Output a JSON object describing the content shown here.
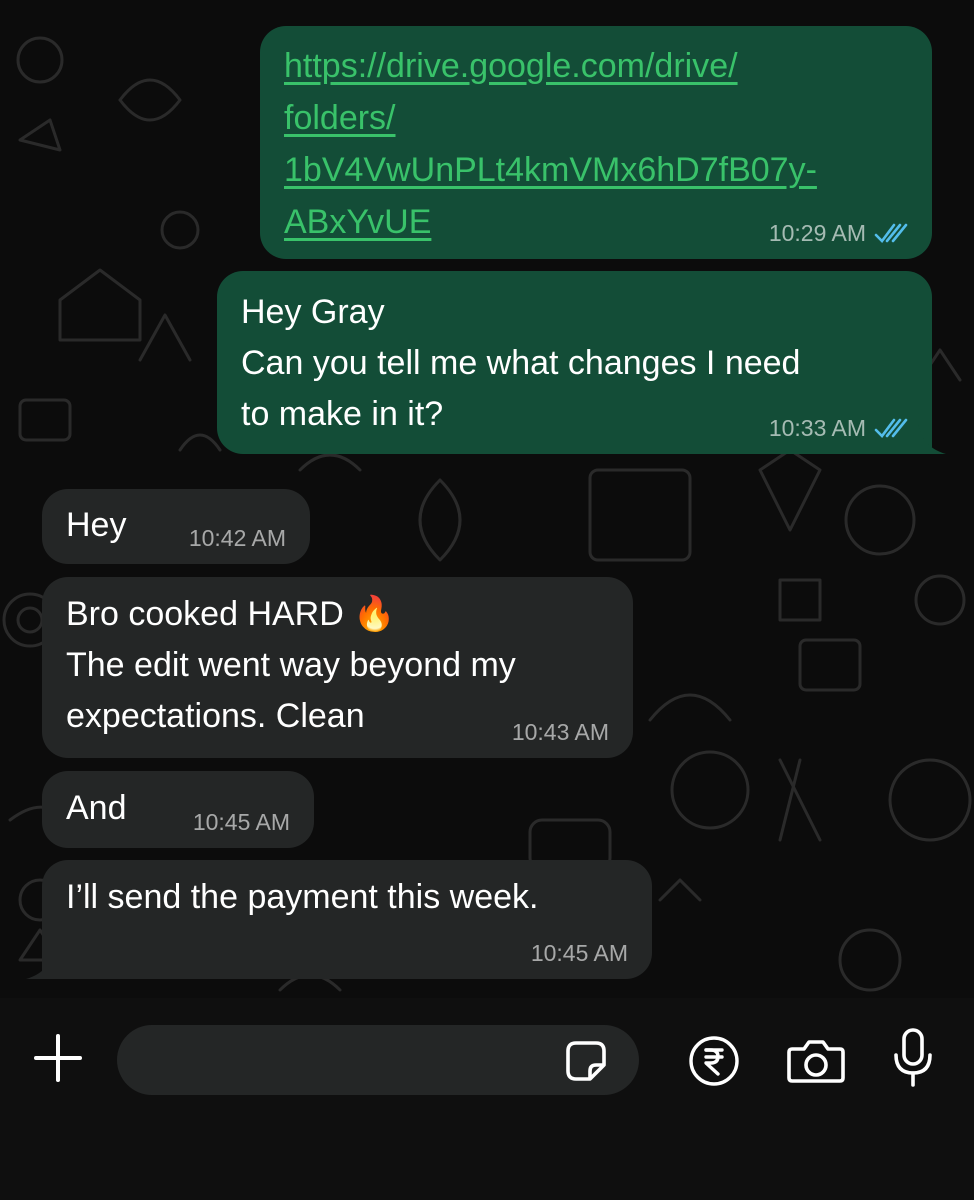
{
  "messages": [
    {
      "id": "m1",
      "direction": "outgoing",
      "link_lines": [
        "https://drive.google.com/drive/",
        "folders/",
        "1bV4VwUnPLt4kmVMx6hD7fB07y-",
        "ABxYvUE"
      ],
      "time": "10:29 AM",
      "read": true
    },
    {
      "id": "m2",
      "direction": "outgoing",
      "lines": [
        "Hey Gray",
        "Can you tell me what changes I need",
        "to make in it?"
      ],
      "time": "10:33 AM",
      "read": true
    },
    {
      "id": "m3",
      "direction": "incoming",
      "lines": [
        "Hey"
      ],
      "time": "10:42 AM"
    },
    {
      "id": "m4",
      "direction": "incoming",
      "lines": [
        "Bro cooked HARD 🔥",
        "The edit went way beyond my",
        "expectations. Clean"
      ],
      "time": "10:43 AM"
    },
    {
      "id": "m5",
      "direction": "incoming",
      "lines": [
        "And"
      ],
      "time": "10:45 AM"
    },
    {
      "id": "m6",
      "direction": "incoming",
      "lines": [
        "I’ll send the payment this week."
      ],
      "time": "10:45 AM"
    }
  ],
  "composer": {
    "input_value": "",
    "icons": [
      "plus-icon",
      "sticker-icon",
      "rupee-payment-icon",
      "camera-icon",
      "microphone-icon"
    ]
  },
  "colors": {
    "outgoing_bubble": "#134d37",
    "incoming_bubble": "#242626",
    "link": "#39c26a",
    "read_ticks": "#53bdeb",
    "background": "#0c0c0c"
  }
}
